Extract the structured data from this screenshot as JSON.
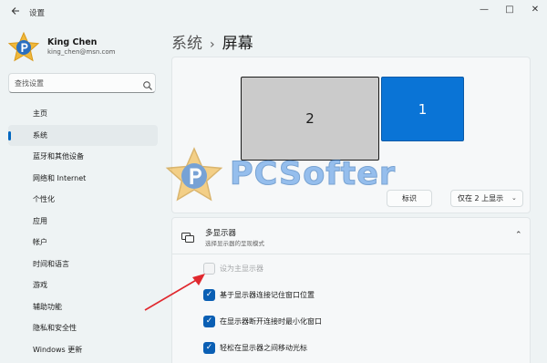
{
  "window": {
    "title": "设置",
    "back_icon": "back-arrow-icon",
    "controls": {
      "minimize": "—",
      "maximize": "□",
      "close": "✕"
    }
  },
  "profile": {
    "name": "King Chen",
    "email": "king_chen@msn.com"
  },
  "search": {
    "placeholder": "查找设置"
  },
  "nav": {
    "items": [
      {
        "label": "主页"
      },
      {
        "label": "系统",
        "active": true
      },
      {
        "label": "蓝牙和其他设备"
      },
      {
        "label": "网络和 Internet"
      },
      {
        "label": "个性化"
      },
      {
        "label": "应用"
      },
      {
        "label": "帐户"
      },
      {
        "label": "时间和语言"
      },
      {
        "label": "游戏"
      },
      {
        "label": "辅助功能"
      },
      {
        "label": "隐私和安全性"
      },
      {
        "label": "Windows 更新"
      }
    ]
  },
  "header": {
    "parent": "系统",
    "separator": "›",
    "current": "屏幕"
  },
  "display": {
    "monitor_1": "1",
    "monitor_2": "2",
    "identify_label": "标识",
    "select_value": "仅在 2 上显示",
    "select_chevron": "⌄"
  },
  "watermark": {
    "text": "PCSofter"
  },
  "multi_display": {
    "title": "多显示器",
    "description": "选择显示器的呈现模式",
    "collapse_glyph": "⌃",
    "options": [
      {
        "label": "设为主显示器",
        "checked": false,
        "disabled": true
      },
      {
        "label": "基于显示器连接记住窗口位置",
        "checked": true,
        "disabled": false
      },
      {
        "label": "在显示器断开连接时最小化窗口",
        "checked": true,
        "disabled": false
      },
      {
        "label": "轻松在显示器之间移动光标",
        "checked": true,
        "disabled": false
      }
    ]
  },
  "colors": {
    "accent": "#0067c0",
    "monitor_selected": "#0a74d6",
    "monitor_other": "#cbcbcb",
    "annotation": "#e0282e"
  }
}
